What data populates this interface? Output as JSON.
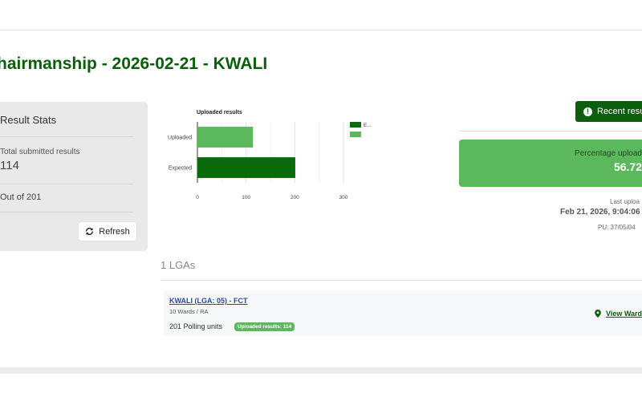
{
  "page": {
    "title": "hairmanship - 2026-02-21 - KWALI"
  },
  "stats": {
    "title": "Result Stats",
    "total_label": "Total submitted results",
    "total_value": "114",
    "out_of": "Out of 201",
    "refresh_label": "Refresh"
  },
  "chart_data": {
    "type": "bar",
    "orientation": "horizontal",
    "title": "Uploaded results",
    "categories": [
      "Uploaded",
      "Expected"
    ],
    "values": [
      114,
      201
    ],
    "colors": [
      "#5cb85c",
      "#0b6b0b"
    ],
    "xlim": [
      0,
      300
    ],
    "xticks": [
      "0",
      "100",
      "200",
      "300"
    ],
    "legend": {
      "placement": "top-right",
      "entries": [
        "E..."
      ]
    },
    "grid": true
  },
  "right_panel": {
    "recent_button_label": "Recent resu",
    "percentage_label": "Percentage upload",
    "percentage_value": "56.72",
    "last_upload_label": "Last uploa",
    "last_upload_date": "Feb 21, 2026, 9:04:06",
    "pu": "PU: 37/05/04"
  },
  "lgas": {
    "heading": "1 LGAs",
    "items": [
      {
        "name": "KWALI (LGA: 05) - FCT",
        "wards": "10 Wards / RA",
        "polling_units": "201 Polling units",
        "badge": "Uploaded results: 114",
        "view_label": "View Ward"
      }
    ]
  },
  "colors": {
    "brand_green": "#0b5e0b",
    "accent_green": "#5cb85c",
    "link_blue": "#2b4aa8"
  }
}
